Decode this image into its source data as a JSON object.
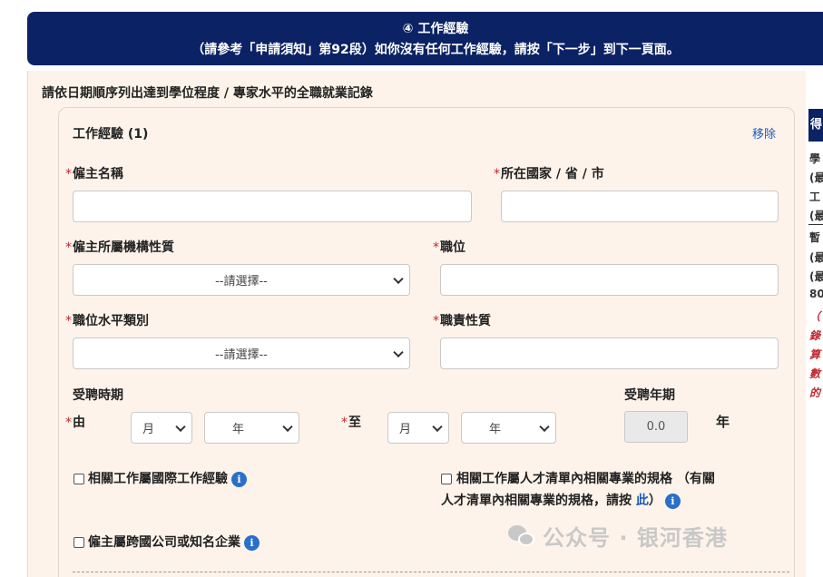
{
  "header": {
    "title": "④ 工作經驗",
    "subtitle": "（請參考「申請須知」第92段）如你沒有任何工作經驗，請按「下一步」到下一頁面。"
  },
  "instruction": "請依日期順序列出達到學位程度 / 專家水平的全職就業記錄",
  "card": {
    "title": "工作經驗 (1)",
    "remove_label": "移除"
  },
  "required_mark": "*",
  "fields": {
    "employer_name": {
      "label": "僱主名稱",
      "value": ""
    },
    "location": {
      "label": "所在國家 / 省 / 市",
      "value": ""
    },
    "employer_type": {
      "label": "僱主所屬機構性質",
      "selected": "--請選擇--"
    },
    "position": {
      "label": "職位",
      "value": ""
    },
    "position_level": {
      "label": "職位水平類別",
      "selected": "--請選擇--"
    },
    "duties": {
      "label": "職責性質",
      "value": ""
    }
  },
  "employment_period": {
    "label": "受聘時期",
    "from_label": "由",
    "to_label": "至",
    "month_placeholder": "月",
    "year_placeholder": "年",
    "years_label": "受聘年期",
    "years_value": "0.0",
    "years_unit": "年"
  },
  "checkboxes": {
    "international": "相關工作屬國際工作經驗",
    "talent_list_line1": "相關工作屬人才清單內相關專業的規格 （有關",
    "talent_list_line2": "人才清單內相關專業的規格，請按 ",
    "talent_list_link": "此",
    "talent_list_end": "）",
    "multinational": "僱主屬跨國公司或知名企業"
  },
  "sidebar": {
    "heading": "得",
    "lines": [
      "學",
      "(最",
      "工",
      "(最",
      "暫",
      "(最",
      "(最",
      "80"
    ],
    "red_lines": [
      "（",
      "錄",
      "算",
      "數",
      "的"
    ]
  },
  "watermark": "公众号 · 银河香港",
  "colors": {
    "header_bg": "#0b2264",
    "panel_bg": "#fdf3ea",
    "required": "#c0282e",
    "link": "#1a5ab8",
    "info_icon": "#2a6fc9"
  }
}
